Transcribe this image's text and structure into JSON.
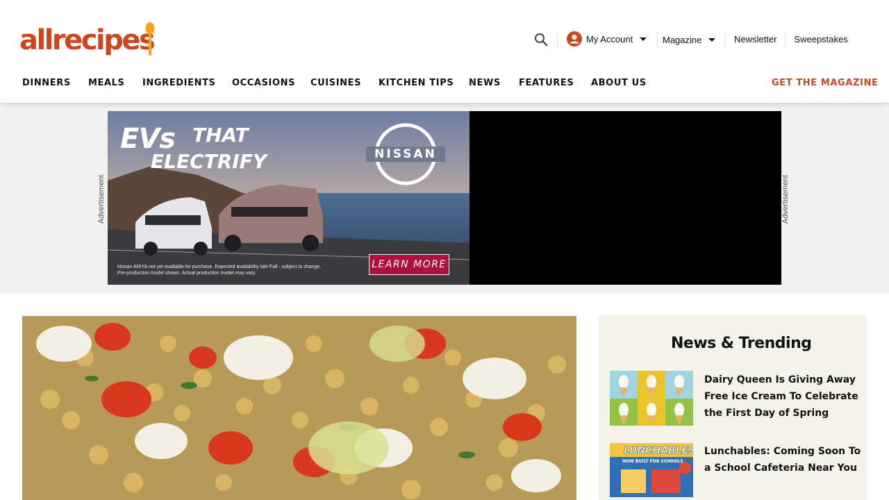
{
  "header": {
    "logo_text": "allrecipes",
    "account_label": "My Account",
    "magazine_label": "Magazine",
    "newsletter_label": "Newsletter",
    "sweepstakes_label": "Sweepstakes"
  },
  "nav": {
    "items": [
      {
        "label": "DINNERS"
      },
      {
        "label": "MEALS"
      },
      {
        "label": "INGREDIENTS"
      },
      {
        "label": "OCCASIONS"
      },
      {
        "label": "CUISINES"
      },
      {
        "label": "KITCHEN TIPS"
      },
      {
        "label": "NEWS"
      },
      {
        "label": "FEATURES"
      },
      {
        "label": "ABOUT US"
      }
    ],
    "cta_label": "GET THE MAGAZINE"
  },
  "ad": {
    "side_label": "Advertisement",
    "headline_ev": "EVs",
    "headline_that": "THAT",
    "headline_electrify": "ELECTRIFY",
    "brand": "NISSAN",
    "cta": "LEARN MORE",
    "disclaimer": "Nissan ARIYA not yet available for purchase. Expected availability late Fall - subject to change. Pre-production model shown. Actual production model may vary."
  },
  "sidebar": {
    "title": "News & Trending",
    "items": [
      {
        "title": "Dairy Queen Is Giving Away Free Ice Cream To Celebrate the First Day of Spring"
      },
      {
        "title": "Lunchables: Coming Soon To a School Cafeteria Near You",
        "thumb_text": "LUNCHABLES",
        "thumb_sub": "NOW BUILT FOR SCHOOLS"
      }
    ]
  },
  "colors": {
    "brand": "#ce4620",
    "ad_cta": "#b0103d",
    "sidebar_bg": "#f4f3ea"
  },
  "icons": [
    "search-icon",
    "account-icon",
    "caret-down-icon",
    "spoon-icon",
    "nissan-logo-icon"
  ]
}
